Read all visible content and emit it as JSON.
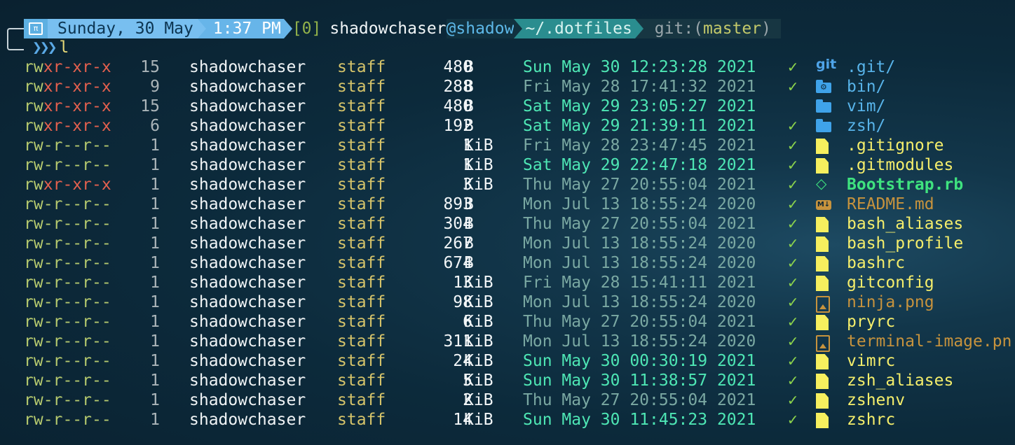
{
  "prompt": {
    "os_icon": "apple-terminal-icon",
    "date": "Sunday, 30 May",
    "time": "1:37 PM",
    "job": "[0]",
    "user": "shadowchaser",
    "host": "@shadow",
    "dir": "~/.dotfiles",
    "git_label": "git:(",
    "git_branch": "master",
    "git_close": ")",
    "chevrons": "❯❯❯",
    "command": "l"
  },
  "colors": {
    "recent_date": "#4ee6b4",
    "old_date": "#7aa8a2",
    "dir": "#58b4ea",
    "file": "#f5ee6b",
    "exec": "#3fe37f",
    "doc": "#c7933d"
  },
  "files": [
    {
      "perm": "rwxr-xr-x",
      "links": "15",
      "owner": "shadowchaser",
      "group": "staff",
      "size": "480",
      "unit": "B",
      "date": "Sun May 30 12:23:28 2021",
      "recent": true,
      "git": "✓",
      "icon": "git-icon",
      "name": ".git/",
      "kind": "dir"
    },
    {
      "perm": "rwxr-xr-x",
      "links": "9",
      "owner": "shadowchaser",
      "group": "staff",
      "size": "288",
      "unit": "B",
      "date": "Fri May 28 17:41:32 2021",
      "recent": false,
      "git": "✓",
      "icon": "gear-folder-icon",
      "name": "bin/",
      "kind": "dir"
    },
    {
      "perm": "rwxr-xr-x",
      "links": "15",
      "owner": "shadowchaser",
      "group": "staff",
      "size": "480",
      "unit": "B",
      "date": "Sat May 29 23:05:27 2021",
      "recent": true,
      "git": "",
      "icon": "folder-icon",
      "name": "vim/",
      "kind": "dir"
    },
    {
      "perm": "rwxr-xr-x",
      "links": "6",
      "owner": "shadowchaser",
      "group": "staff",
      "size": "192",
      "unit": "B",
      "date": "Sat May 29 21:39:11 2021",
      "recent": true,
      "git": "✓",
      "icon": "folder-icon",
      "name": "zsh/",
      "kind": "dir"
    },
    {
      "perm": "rw-r--r--",
      "links": "1",
      "owner": "shadowchaser",
      "group": "staff",
      "size": "1",
      "unit": "KiB",
      "date": "Fri May 28 23:47:45 2021",
      "recent": false,
      "git": "✓",
      "icon": "file-icon",
      "name": ".gitignore",
      "kind": "file"
    },
    {
      "perm": "rw-r--r--",
      "links": "1",
      "owner": "shadowchaser",
      "group": "staff",
      "size": "1",
      "unit": "KiB",
      "date": "Sat May 29 22:47:18 2021",
      "recent": true,
      "git": "✓",
      "icon": "file-icon",
      "name": ".gitmodules",
      "kind": "file"
    },
    {
      "perm": "rwxr-xr-x",
      "links": "1",
      "owner": "shadowchaser",
      "group": "staff",
      "size": "3",
      "unit": "KiB",
      "date": "Thu May 27 20:55:04 2021",
      "recent": false,
      "git": "✓",
      "icon": "ruby-gem-icon",
      "name": "Bootstrap.rb",
      "kind": "exec"
    },
    {
      "perm": "rw-r--r--",
      "links": "1",
      "owner": "shadowchaser",
      "group": "staff",
      "size": "893",
      "unit": "B",
      "date": "Mon Jul 13 18:55:24 2020",
      "recent": false,
      "git": "✓",
      "icon": "markdown-icon",
      "name": "README.md",
      "kind": "doc"
    },
    {
      "perm": "rw-r--r--",
      "links": "1",
      "owner": "shadowchaser",
      "group": "staff",
      "size": "304",
      "unit": "B",
      "date": "Thu May 27 20:55:04 2021",
      "recent": false,
      "git": "✓",
      "icon": "file-icon",
      "name": "bash_aliases",
      "kind": "file"
    },
    {
      "perm": "rw-r--r--",
      "links": "1",
      "owner": "shadowchaser",
      "group": "staff",
      "size": "267",
      "unit": "B",
      "date": "Mon Jul 13 18:55:24 2020",
      "recent": false,
      "git": "✓",
      "icon": "file-icon",
      "name": "bash_profile",
      "kind": "file"
    },
    {
      "perm": "rw-r--r--",
      "links": "1",
      "owner": "shadowchaser",
      "group": "staff",
      "size": "674",
      "unit": "B",
      "date": "Mon Jul 13 18:55:24 2020",
      "recent": false,
      "git": "✓",
      "icon": "file-icon",
      "name": "bashrc",
      "kind": "file"
    },
    {
      "perm": "rw-r--r--",
      "links": "1",
      "owner": "shadowchaser",
      "group": "staff",
      "size": "13",
      "unit": "KiB",
      "date": "Fri May 28 15:41:11 2021",
      "recent": false,
      "git": "✓",
      "icon": "file-icon",
      "name": "gitconfig",
      "kind": "file"
    },
    {
      "perm": "rw-r--r--",
      "links": "1",
      "owner": "shadowchaser",
      "group": "staff",
      "size": "98",
      "unit": "KiB",
      "date": "Mon Jul 13 18:55:24 2020",
      "recent": false,
      "git": "✓",
      "icon": "image-icon",
      "name": "ninja.png",
      "kind": "img"
    },
    {
      "perm": "rw-r--r--",
      "links": "1",
      "owner": "shadowchaser",
      "group": "staff",
      "size": "6",
      "unit": "KiB",
      "date": "Thu May 27 20:55:04 2021",
      "recent": false,
      "git": "✓",
      "icon": "file-icon",
      "name": "pryrc",
      "kind": "file"
    },
    {
      "perm": "rw-r--r--",
      "links": "1",
      "owner": "shadowchaser",
      "group": "staff",
      "size": "311",
      "unit": "KiB",
      "date": "Mon Jul 13 18:55:24 2020",
      "recent": false,
      "git": "✓",
      "icon": "image-icon",
      "name": "terminal-image.pn",
      "kind": "img"
    },
    {
      "perm": "rw-r--r--",
      "links": "1",
      "owner": "shadowchaser",
      "group": "staff",
      "size": "24",
      "unit": "KiB",
      "date": "Sun May 30 00:30:19 2021",
      "recent": true,
      "git": "✓",
      "icon": "file-icon",
      "name": "vimrc",
      "kind": "file"
    },
    {
      "perm": "rw-r--r--",
      "links": "1",
      "owner": "shadowchaser",
      "group": "staff",
      "size": "5",
      "unit": "KiB",
      "date": "Sun May 30 11:38:57 2021",
      "recent": true,
      "git": "✓",
      "icon": "file-icon",
      "name": "zsh_aliases",
      "kind": "file"
    },
    {
      "perm": "rw-r--r--",
      "links": "1",
      "owner": "shadowchaser",
      "group": "staff",
      "size": "2",
      "unit": "KiB",
      "date": "Thu May 27 20:55:04 2021",
      "recent": false,
      "git": "✓",
      "icon": "file-icon",
      "name": "zshenv",
      "kind": "file"
    },
    {
      "perm": "rw-r--r--",
      "links": "1",
      "owner": "shadowchaser",
      "group": "staff",
      "size": "14",
      "unit": "KiB",
      "date": "Sun May 30 11:45:23 2021",
      "recent": true,
      "git": "✓",
      "icon": "file-icon",
      "name": "zshrc",
      "kind": "file"
    }
  ]
}
